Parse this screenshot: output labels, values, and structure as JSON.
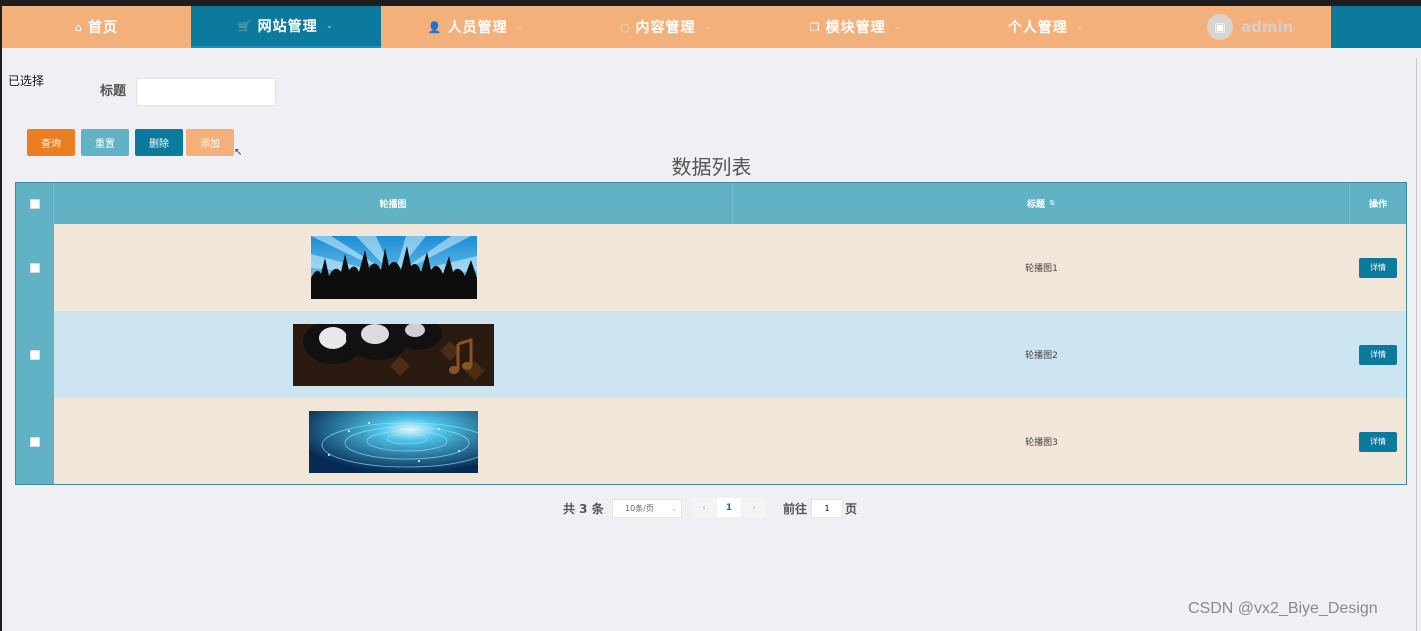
{
  "nav": {
    "items": [
      {
        "label": "首页",
        "icon": "home-icon",
        "glyph": "⌂",
        "caret": ""
      },
      {
        "label": "网站管理",
        "icon": "cart-icon",
        "glyph": "🛒",
        "caret": "⌄"
      },
      {
        "label": "人员管理",
        "icon": "user-icon",
        "glyph": "👤",
        "caret": "⌄"
      },
      {
        "label": "内容管理",
        "icon": "chat-icon",
        "glyph": "◌",
        "caret": "⌄"
      },
      {
        "label": "模块管理",
        "icon": "copy-icon",
        "glyph": "❐",
        "caret": "⌄"
      },
      {
        "label": "个人管理",
        "icon": "",
        "glyph": "",
        "caret": "⌄"
      }
    ],
    "active_index": 1,
    "user": {
      "name": "admin",
      "avatar_icon": "image-icon",
      "avatar_glyph": "▣"
    }
  },
  "breadcrumb": "已选择",
  "search": {
    "label": "标题",
    "value": "",
    "placeholder": ""
  },
  "toolbar": {
    "query_label": "查询",
    "reset_label": "重置",
    "delete_label": "删除",
    "add_label": "添加"
  },
  "table": {
    "title": "数据列表",
    "columns": {
      "image": "轮播图",
      "title": "标题",
      "actions": "操作"
    },
    "rows": [
      {
        "title": "轮播图1",
        "action_label": "详情",
        "image": "concert-crowd-silhouette"
      },
      {
        "title": "轮播图2",
        "action_label": "详情",
        "image": "vinyl-records-music-notes"
      },
      {
        "title": "轮播图3",
        "action_label": "详情",
        "image": "water-ripple-glow"
      }
    ]
  },
  "pagination": {
    "total_text": "共 3 条",
    "page_size": "10条/页",
    "prev_glyph": "‹",
    "next_glyph": "›",
    "current_page": "1",
    "goto_label": "前往",
    "goto_value": "1",
    "page_suffix": "页"
  },
  "watermark": "CSDN @vx2_Biye_Design",
  "colors": {
    "nav_bg": "#f4b07b",
    "nav_active": "#0b7a9c",
    "table_header": "#60b2c4",
    "row_odd": "#f1e6d8",
    "row_even": "#cde4f1",
    "query_btn": "#ec7e22",
    "reset_btn": "#62b2c6",
    "delete_btn": "#0b7a9c",
    "add_btn": "#f4b07b"
  }
}
